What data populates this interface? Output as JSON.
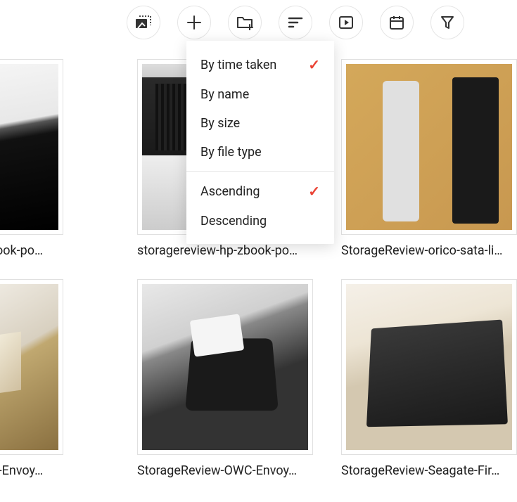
{
  "toolbar": {
    "select_photos": "Select photos",
    "add": "Add",
    "new_folder": "New folder",
    "sort": "Sort",
    "slideshow": "Slideshow",
    "date": "Date",
    "filter": "Filter"
  },
  "sort_menu": {
    "groups": [
      {
        "options": [
          {
            "key": "by_time_taken",
            "label": "By time taken",
            "selected": true
          },
          {
            "key": "by_name",
            "label": "By name",
            "selected": false
          },
          {
            "key": "by_size",
            "label": "By size",
            "selected": false
          },
          {
            "key": "by_file_type",
            "label": "By file type",
            "selected": false
          }
        ]
      },
      {
        "options": [
          {
            "key": "ascending",
            "label": "Ascending",
            "selected": true
          },
          {
            "key": "descending",
            "label": "Descending",
            "selected": false
          }
        ]
      }
    ]
  },
  "gallery": {
    "items": [
      {
        "caption": "-zbook-po…"
      },
      {
        "caption": "storagereview-hp-zbook-po…"
      },
      {
        "caption": "StorageReview-orico-sata-li…"
      },
      {
        "caption": "WC-Envoy…"
      },
      {
        "caption": "StorageReview-OWC-Envoy…"
      },
      {
        "caption": "StorageReview-Seagate-Fir…"
      }
    ]
  },
  "check_glyph": "✓"
}
